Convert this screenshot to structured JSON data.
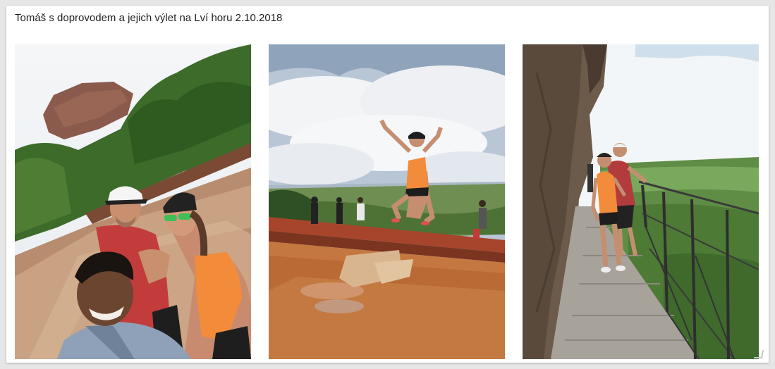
{
  "post": {
    "caption": "Tomáš s doprovodem a jejich výlet na Lví horu 2.10.2018"
  },
  "photos": [
    {
      "alt": "Tomáš s doprovodem a jejich výlet na Lví horu 2.10.2018"
    },
    {
      "alt": "Tomáš s doprovodem a jejich výlet na Lví horu 2.10.2018"
    },
    {
      "alt": "Tomáš s doprovodem a jejich výlet na Lví horu 2.10.2018"
    }
  ]
}
